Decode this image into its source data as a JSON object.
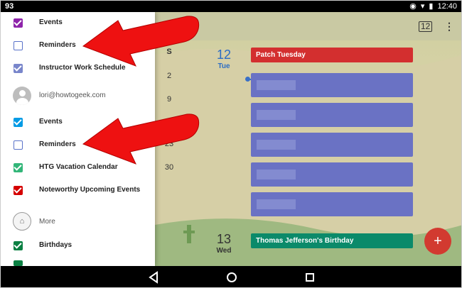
{
  "status_bar": {
    "notification_count": "93",
    "time": "12:40"
  },
  "calendar": {
    "day_header_letter": "S",
    "mini_dates": [
      "2",
      "9",
      "23",
      "30"
    ],
    "date1": {
      "num": "12",
      "weekday": "Tue"
    },
    "date2": {
      "num": "13",
      "weekday": "Wed"
    },
    "event_patch": "Patch Tuesday",
    "event_birthday": "Thomas Jefferson's Birthday",
    "today_icon_text": "12",
    "fab_label": "+",
    "colors": {
      "patch": "#d32f2f",
      "birthday": "#0b8a6a",
      "event_block": "#6a72c4"
    }
  },
  "drawer": {
    "items": [
      {
        "label": "Events",
        "checked": true,
        "color": "#8e24aa"
      },
      {
        "label": "Reminders",
        "checked": false,
        "color": "#5a73c9"
      },
      {
        "label": "Instructor Work Schedule",
        "checked": true,
        "color": "#7986cb"
      }
    ],
    "account_email": "lori@howtogeek.com",
    "account_items": [
      {
        "label": "Events",
        "checked": true,
        "color": "#039be5"
      },
      {
        "label": "Reminders",
        "checked": false,
        "color": "#5a73c9"
      },
      {
        "label": "HTG Vacation Calendar",
        "checked": true,
        "color": "#33b679"
      },
      {
        "label": "Noteworthy Upcoming Events",
        "checked": true,
        "color": "#d50000"
      }
    ],
    "more_label": "More",
    "birthdays": {
      "label": "Birthdays",
      "checked": true,
      "color": "#0b8043"
    }
  },
  "annotation_color": "#ff0000"
}
